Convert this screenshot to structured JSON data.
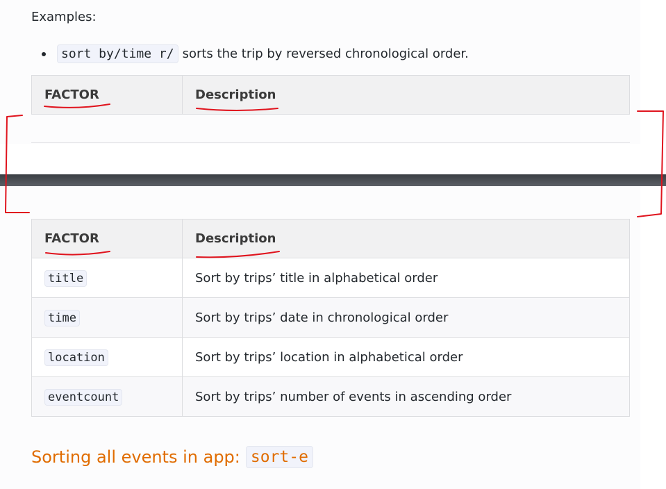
{
  "doc": {
    "examples_label": "Examples:",
    "example": {
      "command": "sort by/time r/",
      "text": "sorts the trip by reversed chronological order."
    },
    "table_top": {
      "headers": [
        "FACTOR",
        "Description"
      ]
    },
    "table_bottom": {
      "headers": [
        "FACTOR",
        "Description"
      ],
      "rows": [
        {
          "factor": "title",
          "description": "Sort by trips’ title in alphabetical order"
        },
        {
          "factor": "time",
          "description": "Sort by trips’ date in chronological order"
        },
        {
          "factor": "location",
          "description": "Sort by trips’ location in alphabetical order"
        },
        {
          "factor": "eventcount",
          "description": "Sort by trips’ number of events in ascending order"
        }
      ]
    },
    "section_heading": {
      "text": "Sorting all events in app:",
      "command": "sort-e"
    }
  },
  "colors": {
    "heading_accent": "#e06c00",
    "annotation_red": "#e0141e",
    "divider": "#4a4e53"
  }
}
